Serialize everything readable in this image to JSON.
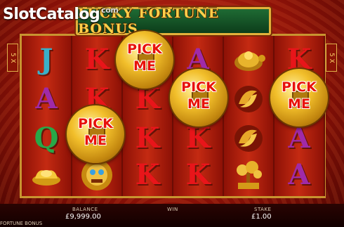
{
  "watermark": {
    "text": "SlotCatalog",
    "dot": "com"
  },
  "title": "LUCKY FORTUNE BONUS",
  "side_left": "5 X",
  "side_right": "5 X",
  "reels": [
    [
      "J",
      "A",
      "Q",
      "gold-ingot-icon"
    ],
    [
      "K",
      "K",
      "K",
      "lion-icon"
    ],
    [
      "K",
      "K",
      "K",
      "K"
    ],
    [
      "A",
      "A",
      "K",
      "K"
    ],
    [
      "turtle-icon",
      "koi-fish-icon",
      "koi-fish-icon",
      "bonsai-icon"
    ],
    [
      "K",
      "A",
      "A",
      "A"
    ]
  ],
  "colors": {
    "J": "#3ab0c8",
    "A": "#a02aa8",
    "Q": "#28a848",
    "K": "#e8151a"
  },
  "coins": [
    {
      "line1": "PICK",
      "line2": "ME"
    },
    {
      "line1": "PICK",
      "line2": "ME"
    },
    {
      "line1": "PICK",
      "line2": "ME"
    },
    {
      "line1": "PICK",
      "line2": "ME"
    }
  ],
  "balance": {
    "label": "BALANCE",
    "value": "£9,999.00"
  },
  "win": {
    "label": "WIN"
  },
  "stake": {
    "label": "STAKE",
    "value": "£1.00"
  },
  "mode": "FORTUNE BONUS"
}
